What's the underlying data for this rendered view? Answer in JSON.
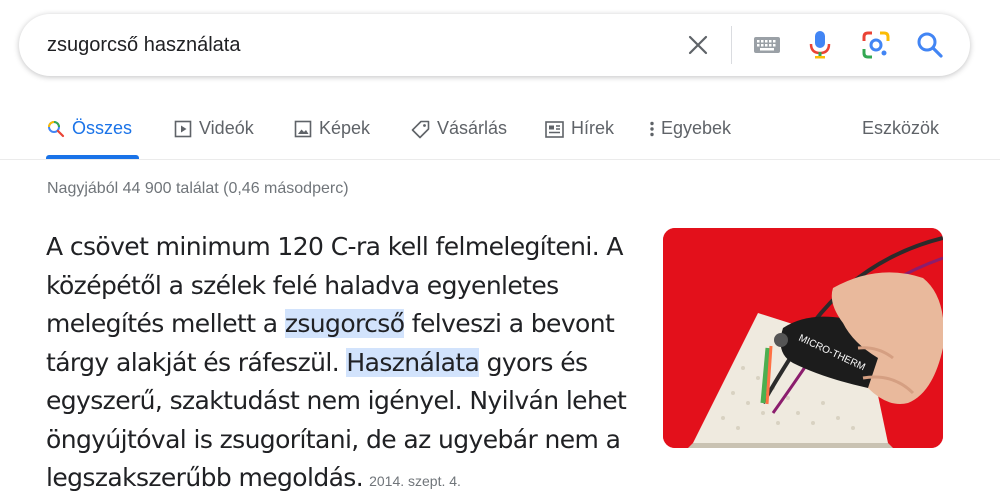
{
  "search": {
    "query": "zsugorcső használata"
  },
  "tabs": [
    {
      "label": "Összes",
      "icon": "search-icon",
      "active": true
    },
    {
      "label": "Videók",
      "icon": "play-icon"
    },
    {
      "label": "Képek",
      "icon": "image-icon"
    },
    {
      "label": "Vásárlás",
      "icon": "tag-icon"
    },
    {
      "label": "Hírek",
      "icon": "news-icon"
    },
    {
      "label": "Egyebek",
      "icon": "more-vert-icon"
    }
  ],
  "tools_label": "Eszközök",
  "stats": "Nagyjából 44 900 találat (0,46 másodperc)",
  "snippet": {
    "part1": "A csövet minimum 120 C-ra kell felmelegíteni. A középétől a szélek felé haladva egyenletes melegítés mellett a ",
    "hl1": "zsugorcső",
    "part2": " felveszi a bevont tárgy alakját és ráfeszül. ",
    "hl2": "Használata",
    "part3": " gyors és egyszerű, szaktudást nem igényel. Nyilván lehet öngyújtóval is zsugorítani, de az ugyebár nem a legszakszerűbb megoldás.",
    "date": "2014. szept. 4."
  },
  "colors": {
    "accent": "#1a73e8",
    "highlight": "#d2e3fc",
    "thumb_bg": "#e3101b"
  }
}
